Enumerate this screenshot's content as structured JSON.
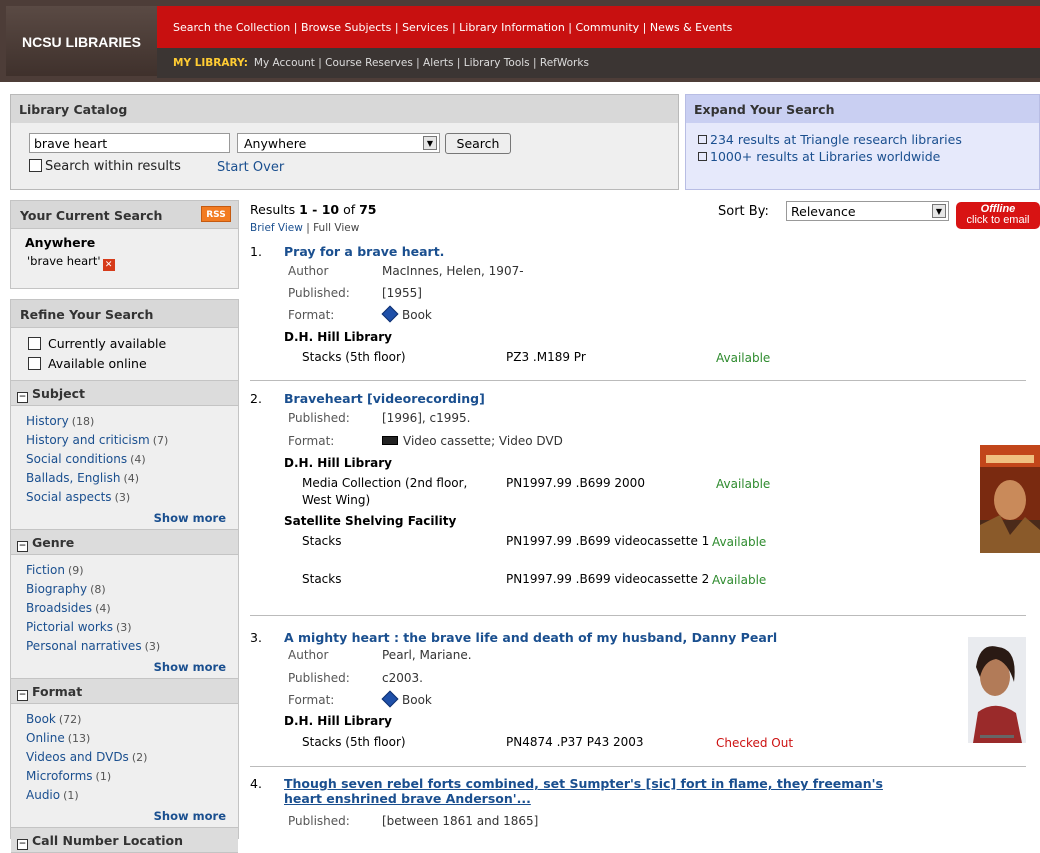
{
  "header": {
    "logo": "NCSU LIBRARIES",
    "nav_main": [
      "Search the Collection",
      "Browse Subjects",
      "Services",
      "Library Information",
      "Community",
      "News & Events"
    ],
    "my_library_label": "MY LIBRARY:",
    "nav_my": [
      "My Account",
      "Course Reserves",
      "Alerts",
      "Library Tools",
      "RefWorks"
    ],
    "sep": " | "
  },
  "catalog": {
    "title": "Library Catalog",
    "query": "brave heart",
    "scope": "Anywhere",
    "search_button": "Search",
    "within_label": "Search within results",
    "start_over": "Start Over"
  },
  "expand": {
    "title": "Expand Your Search",
    "links": [
      "234 results at Triangle research libraries",
      "1000+ results at Libraries worldwide"
    ]
  },
  "current": {
    "title": "Your Current Search",
    "rss": "RSS",
    "field": "Anywhere",
    "term": "'brave heart'",
    "remove_glyph": "✕"
  },
  "refine": {
    "title": "Refine Your Search",
    "options": [
      "Currently available",
      "Available online"
    ],
    "show_more": "Show more",
    "facets": [
      {
        "name": "Subject",
        "items": [
          {
            "label": "History",
            "count": "(18)"
          },
          {
            "label": "History and criticism",
            "count": "(7)"
          },
          {
            "label": "Social conditions",
            "count": "(4)"
          },
          {
            "label": "Ballads, English",
            "count": "(4)"
          },
          {
            "label": "Social aspects",
            "count": "(3)"
          }
        ]
      },
      {
        "name": "Genre",
        "items": [
          {
            "label": "Fiction",
            "count": "(9)"
          },
          {
            "label": "Biography",
            "count": "(8)"
          },
          {
            "label": "Broadsides",
            "count": "(4)"
          },
          {
            "label": "Pictorial works",
            "count": "(3)"
          },
          {
            "label": "Personal narratives",
            "count": "(3)"
          }
        ]
      },
      {
        "name": "Format",
        "items": [
          {
            "label": "Book",
            "count": "(72)"
          },
          {
            "label": "Online",
            "count": "(13)"
          },
          {
            "label": "Videos and DVDs",
            "count": "(2)"
          },
          {
            "label": "Microforms",
            "count": "(1)"
          },
          {
            "label": "Audio",
            "count": "(1)"
          }
        ]
      },
      {
        "name": "Call Number Location",
        "items": []
      }
    ]
  },
  "results": {
    "count_prefix": "Results ",
    "range": "1 - 10",
    "of": " of ",
    "total": "75",
    "brief_view": "Brief View",
    "view_sep": " | ",
    "full_view": "Full View",
    "sort_label": "Sort By:",
    "sort_value": "Relevance",
    "offline_line1": "Offline",
    "offline_line2": "click to email",
    "labels": {
      "author": "Author",
      "published": "Published:",
      "format": "Format:"
    },
    "records": [
      {
        "num": "1.",
        "title": "Pray for a brave heart.",
        "author": "MacInnes, Helen, 1907-",
        "published": "[1955]",
        "format": "Book",
        "holdings": [
          {
            "library": "D.H. Hill Library",
            "items": [
              {
                "loc": "Stacks (5th floor)",
                "call": "PZ3 .M189 Pr",
                "status": "Available"
              }
            ]
          }
        ]
      },
      {
        "num": "2.",
        "title": "Braveheart [videorecording]",
        "published": "[1996], c1995.",
        "format": "Video cassette; Video DVD",
        "holdings": [
          {
            "library": "D.H. Hill Library",
            "items": [
              {
                "loc": "Media Collection (2nd floor, West Wing)",
                "call": "PN1997.99 .B699 2000",
                "status": "Available"
              }
            ]
          },
          {
            "library": "Satellite Shelving Facility",
            "items": [
              {
                "loc": "Stacks",
                "call": "PN1997.99 .B699 videocassette 1",
                "status": "Available"
              },
              {
                "loc": "Stacks",
                "call": "PN1997.99 .B699 videocassette 2",
                "status": "Available"
              }
            ]
          }
        ]
      },
      {
        "num": "3.",
        "title": "A mighty heart : the brave life and death of my husband, Danny Pearl",
        "author": "Pearl, Mariane.",
        "published": "c2003.",
        "format": "Book",
        "holdings": [
          {
            "library": "D.H. Hill Library",
            "items": [
              {
                "loc": "Stacks (5th floor)",
                "call": "PN4874 .P37 P43 2003",
                "status": "Checked Out"
              }
            ]
          }
        ]
      },
      {
        "num": "4.",
        "title": "Though seven rebel forts combined, set Sumpter's [sic] fort in flame, they freeman's heart enshrined brave Anderson'...",
        "published": "[between 1861 and 1865]"
      }
    ]
  },
  "colors": {
    "nav_red": "#c81010",
    "link": "#1a4f8f",
    "available": "#2e8b2e",
    "checked_out": "#cc1111"
  }
}
